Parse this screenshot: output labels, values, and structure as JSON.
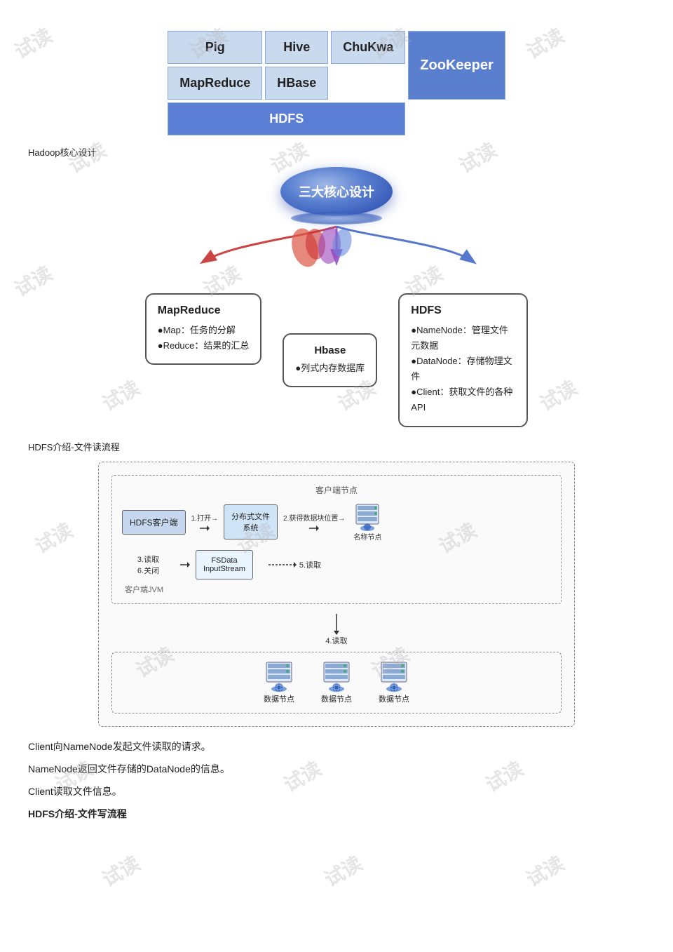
{
  "watermarks": [
    "试读",
    "试读",
    "试读",
    "试读",
    "试读",
    "试读",
    "试读",
    "试读",
    "试读",
    "试读",
    "试读",
    "试读",
    "试读",
    "试读",
    "试读",
    "试读",
    "试读",
    "试读"
  ],
  "hadoop_diagram": {
    "rows": [
      [
        {
          "label": "Pig",
          "colspan": 1,
          "style": "light"
        },
        {
          "label": "Hive",
          "colspan": 1,
          "style": "light"
        },
        {
          "label": "ChuKwa",
          "colspan": 1,
          "style": "light"
        }
      ],
      [
        {
          "label": "MapReduce",
          "colspan": 1,
          "style": "light"
        },
        {
          "label": "HBase",
          "colspan": 1,
          "style": "light"
        },
        {
          "label": "ZooKeeper",
          "colspan": 1,
          "style": "dark-blue",
          "rowspan": 2
        }
      ],
      [
        {
          "label": "HDFS",
          "colspan": 2,
          "style": "medium-blue"
        }
      ]
    ],
    "title": "Hadoop核心设计"
  },
  "core_design": {
    "ball_label": "三大核心设计",
    "mapreduce": {
      "title": "MapReduce",
      "points": [
        "Map：任务的分解",
        "Reduce：结果的汇总"
      ]
    },
    "hbase": {
      "title": "Hbase",
      "points": [
        "列式内存数据库"
      ]
    },
    "hdfs": {
      "title": "HDFS",
      "points": [
        "NameNode：管理文件元数据",
        "DataNode：存储物理文件",
        "Client：获取文件的各种API"
      ]
    }
  },
  "hdfs_read": {
    "section_label": "HDFS介绍-文件读流程",
    "client_area_label": "客户端节点",
    "hdfs_client_label": "HDFS客户端",
    "step1": "1.打开→",
    "distributed_fs_label": "分布式文件\n系统",
    "step2": "2.获得数据块位置→",
    "namenode_label": "名称节点",
    "step3_6": "3.读取\n6.关闭",
    "fsdata_label": "FSData\nInputStream",
    "client_jvm_label": "客户端JVM",
    "step5": "5.读取",
    "step4": "4.读取",
    "datanodes": [
      "数据节点",
      "数据节点",
      "数据节点"
    ]
  },
  "paragraphs": [
    "Client向NameNode发起文件读取的请求。",
    "NameNode返回文件存储的DataNode的信息。",
    "Client读取文件信息。",
    "HDFS介绍-文件写流程"
  ]
}
